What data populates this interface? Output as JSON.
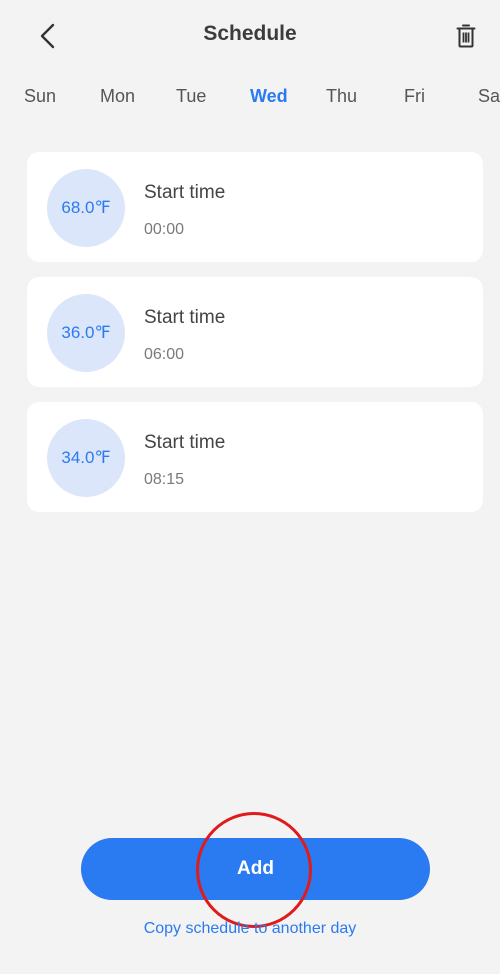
{
  "header": {
    "title": "Schedule",
    "back_icon": "chevron-left-icon",
    "delete_icon": "trash-icon"
  },
  "days": {
    "items": [
      "Sun",
      "Mon",
      "Tue",
      "Wed",
      "Thu",
      "Fri",
      "Sa"
    ],
    "selected": "Wed"
  },
  "schedules": [
    {
      "temp": "68.0℉",
      "label": "Start time",
      "time": "00:00"
    },
    {
      "temp": "36.0℉",
      "label": "Start time",
      "time": "06:00"
    },
    {
      "temp": "34.0℉",
      "label": "Start time",
      "time": "08:15"
    }
  ],
  "actions": {
    "add_label": "Add",
    "copy_label": "Copy schedule to another day"
  },
  "colors": {
    "accent": "#2a7af2",
    "temp_circle": "#dce6fb",
    "annotation": "#e01b1b"
  }
}
